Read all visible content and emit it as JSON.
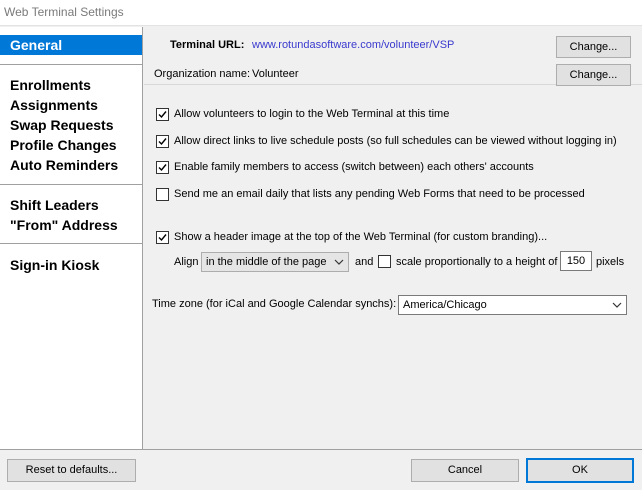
{
  "window": {
    "title": "Web Terminal Settings"
  },
  "sidebar": {
    "items": [
      {
        "label": "General",
        "selected": true
      },
      {
        "label": "Enrollments"
      },
      {
        "label": "Assignments"
      },
      {
        "label": "Swap Requests"
      },
      {
        "label": "Profile Changes"
      },
      {
        "label": "Auto Reminders"
      },
      {
        "label": "Shift Leaders"
      },
      {
        "label": "\"From\" Address"
      },
      {
        "label": "Sign-in Kiosk"
      }
    ]
  },
  "header": {
    "terminal_url_label": "Terminal URL:",
    "terminal_url": "www.rotundasoftware.com/volunteer/VSP",
    "change_url_button": "Change...",
    "org_name_label": "Organization name:",
    "org_name": "Volunteer",
    "change_org_button": "Change..."
  },
  "options": {
    "allow_login": {
      "label": "Allow volunteers to login to the Web Terminal at this time",
      "checked": true
    },
    "direct_links": {
      "label": "Allow direct links to live schedule posts (so full schedules can be viewed without logging in)",
      "checked": true
    },
    "family_members": {
      "label": "Enable family members to access (switch between) each others' accounts",
      "checked": true
    },
    "email_daily": {
      "label": "Send me an email daily that lists any pending Web Forms that need to be processed",
      "checked": false
    },
    "header_image": {
      "label": "Show a header image at the top of the Web Terminal (for custom branding)...",
      "checked": true
    },
    "align_label": "Align",
    "align_value": "in the middle of the page",
    "and_label": "and",
    "scale": {
      "label": "scale proportionally to a height of",
      "checked": false
    },
    "height_value": "150",
    "pixels_label": "pixels",
    "timezone_label": "Time zone (for iCal and Google Calendar synchs):",
    "timezone_value": "America/Chicago"
  },
  "footer": {
    "reset_button": "Reset to defaults...",
    "cancel_button": "Cancel",
    "ok_button": "OK"
  },
  "colors": {
    "selection": "#0078d7",
    "link": "#3a3acf"
  }
}
